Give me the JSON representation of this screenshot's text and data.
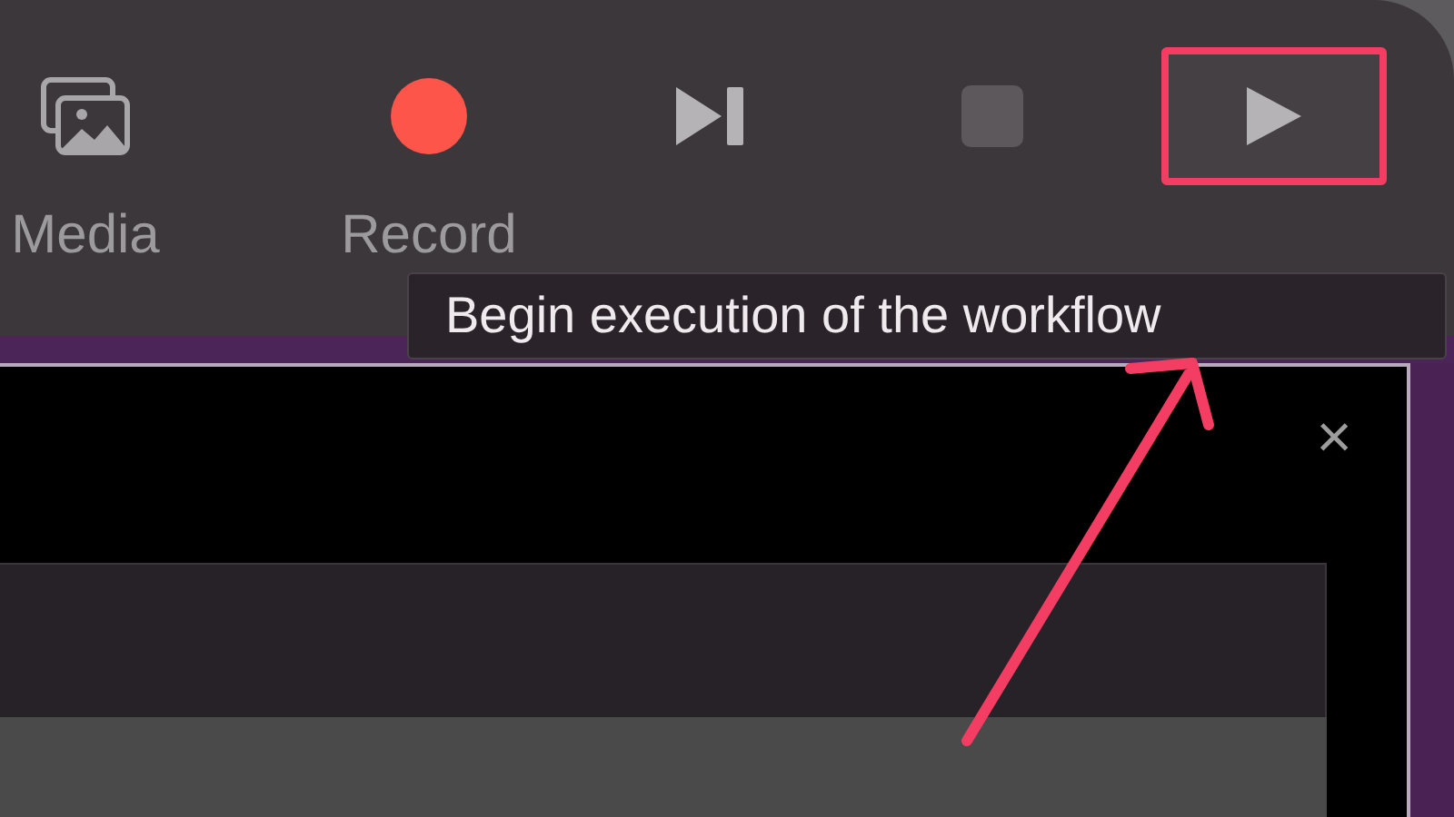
{
  "toolbar": {
    "buttons": [
      {
        "kind": "media",
        "label": "Media",
        "disabled": false,
        "highlighted": false
      },
      {
        "kind": "record",
        "label": "Record",
        "disabled": false,
        "highlighted": false
      },
      {
        "kind": "step",
        "disabled": false,
        "highlighted": false
      },
      {
        "kind": "stop",
        "disabled": true,
        "highlighted": false
      },
      {
        "kind": "run",
        "disabled": false,
        "highlighted": true
      }
    ]
  },
  "tooltip": {
    "text": "Begin execution of the workflow"
  },
  "panel": {
    "close": "×"
  }
}
